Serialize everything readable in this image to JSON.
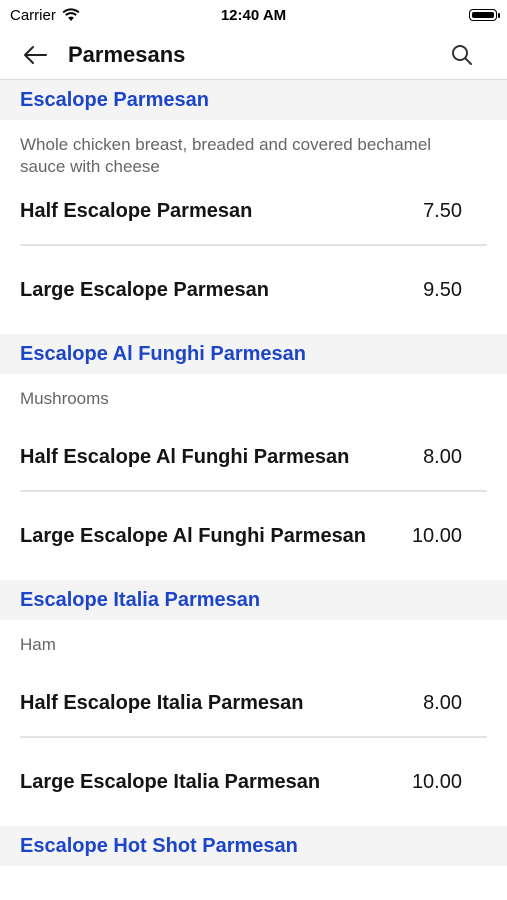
{
  "status_bar": {
    "carrier": "Carrier",
    "time": "12:40 AM"
  },
  "nav": {
    "title": "Parmesans"
  },
  "sections": [
    {
      "title": "Escalope Parmesan",
      "description": "Whole chicken breast, breaded and covered bechamel sauce with cheese",
      "items": [
        {
          "name": "Half Escalope Parmesan",
          "price": "7.50"
        },
        {
          "name": "Large Escalope Parmesan",
          "price": "9.50"
        }
      ]
    },
    {
      "title": "Escalope Al Funghi Parmesan",
      "description": "Mushrooms",
      "items": [
        {
          "name": "Half Escalope Al Funghi Parmesan",
          "price": "8.00"
        },
        {
          "name": "Large Escalope Al Funghi Parmesan",
          "price": "10.00"
        }
      ]
    },
    {
      "title": "Escalope Italia Parmesan",
      "description": "Ham",
      "items": [
        {
          "name": "Half Escalope Italia Parmesan",
          "price": "8.00"
        },
        {
          "name": "Large Escalope Italia Parmesan",
          "price": "10.00"
        }
      ]
    },
    {
      "title": "Escalope Hot Shot Parmesan"
    }
  ],
  "icons": {
    "back": "arrow-left-icon",
    "search": "search-icon",
    "wifi": "wifi-icon",
    "battery": "battery-icon"
  },
  "colors": {
    "accent": "#1c45c9",
    "section_bg": "#f4f4f4",
    "divider": "#e3e3e3"
  }
}
